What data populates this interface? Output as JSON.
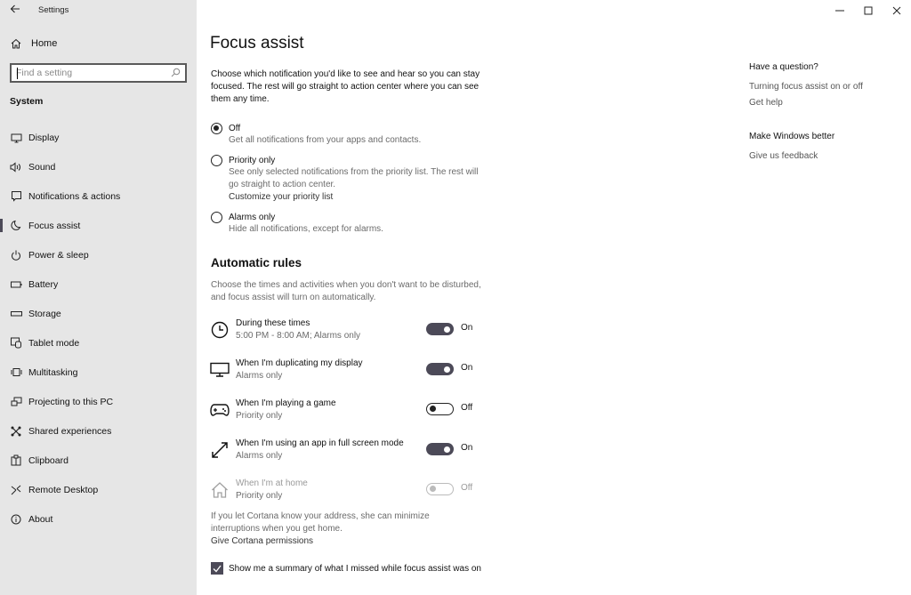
{
  "window": {
    "title": "Settings",
    "controls": {
      "minimize": "minimize-icon",
      "maximize": "maximize-icon",
      "close": "close-icon"
    }
  },
  "sidebar": {
    "home_label": "Home",
    "search_placeholder": "Find a setting",
    "section_label": "System",
    "items": [
      {
        "label": "Display",
        "icon": "display-icon",
        "active": false
      },
      {
        "label": "Sound",
        "icon": "sound-icon",
        "active": false
      },
      {
        "label": "Notifications & actions",
        "icon": "notifications-icon",
        "active": false
      },
      {
        "label": "Focus assist",
        "icon": "moon-icon",
        "active": true
      },
      {
        "label": "Power & sleep",
        "icon": "power-icon",
        "active": false
      },
      {
        "label": "Battery",
        "icon": "battery-icon",
        "active": false
      },
      {
        "label": "Storage",
        "icon": "storage-icon",
        "active": false
      },
      {
        "label": "Tablet mode",
        "icon": "tablet-mode-icon",
        "active": false
      },
      {
        "label": "Multitasking",
        "icon": "multitasking-icon",
        "active": false
      },
      {
        "label": "Projecting to this PC",
        "icon": "projecting-icon",
        "active": false
      },
      {
        "label": "Shared experiences",
        "icon": "shared-experiences-icon",
        "active": false
      },
      {
        "label": "Clipboard",
        "icon": "clipboard-icon",
        "active": false
      },
      {
        "label": "Remote Desktop",
        "icon": "remote-desktop-icon",
        "active": false
      },
      {
        "label": "About",
        "icon": "info-icon",
        "active": false
      }
    ]
  },
  "main": {
    "title": "Focus assist",
    "intro": "Choose which notification you'd like to see and hear so you can stay focused. The rest will go straight to action center where you can see them any time.",
    "options": [
      {
        "label": "Off",
        "desc": "Get all notifications from your apps and contacts.",
        "selected": true,
        "link": null
      },
      {
        "label": "Priority only",
        "desc": "See only selected notifications from the priority list. The rest will go straight to action center.",
        "selected": false,
        "link": "Customize your priority list"
      },
      {
        "label": "Alarms only",
        "desc": "Hide all notifications, except for alarms.",
        "selected": false,
        "link": null
      }
    ],
    "rules_heading": "Automatic rules",
    "rules_desc": "Choose the times and activities when you don't want to be disturbed, and focus assist will turn on automatically.",
    "rules": [
      {
        "title": "During these times",
        "sub": "5:00 PM - 8:00 AM; Alarms only",
        "on": true,
        "state": "On",
        "icon": "clock-icon",
        "disabled": false
      },
      {
        "title": "When I'm duplicating my display",
        "sub": "Alarms only",
        "on": true,
        "state": "On",
        "icon": "monitor-icon",
        "disabled": false
      },
      {
        "title": "When I'm playing a game",
        "sub": "Priority only",
        "on": false,
        "state": "Off",
        "icon": "gamepad-icon",
        "disabled": false
      },
      {
        "title": "When I'm using an app in full screen mode",
        "sub": "Alarms only",
        "on": true,
        "state": "On",
        "icon": "fullscreen-icon",
        "disabled": false
      },
      {
        "title": "When I'm at home",
        "sub": "Priority only",
        "on": false,
        "state": "Off",
        "icon": "home-icon",
        "disabled": true
      }
    ],
    "cortana_text": "If you let Cortana know your address, she can minimize interruptions when you get home.",
    "cortana_link": "Give Cortana permissions",
    "summary_checkbox": {
      "label": "Show me a summary of what I missed while focus assist was on",
      "checked": true
    }
  },
  "aside": {
    "question_heading": "Have a question?",
    "links": [
      "Turning focus assist on or off",
      "Get help"
    ],
    "better_heading": "Make Windows better",
    "feedback_link": "Give us feedback"
  },
  "colors": {
    "accent": "#4c4a58",
    "sidebar_bg": "#e6e6e6",
    "muted_text": "#6b6b6b"
  }
}
